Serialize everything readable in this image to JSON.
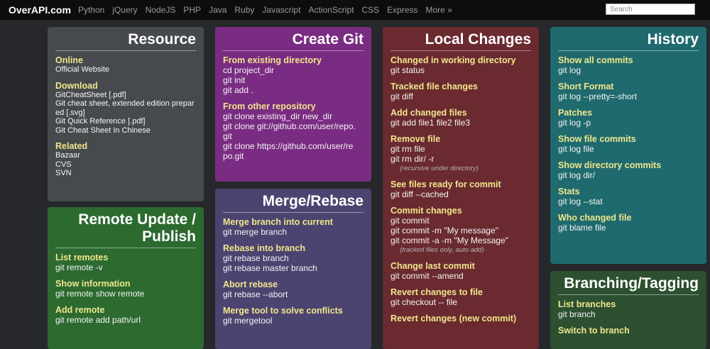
{
  "header": {
    "logo": "OverAPI.com",
    "nav": [
      "Python",
      "jQuery",
      "NodeJS",
      "PHP",
      "Java",
      "Ruby",
      "Javascript",
      "ActionScript",
      "CSS",
      "Express",
      "More »"
    ],
    "search_placeholder": "Search"
  },
  "colors": {
    "resource": "#474a4d",
    "remote": "#2c6a30",
    "create": "#7a2c82",
    "merge": "#4c4470",
    "local": "#6a2a30",
    "history": "#1f6a6e",
    "branching": "#2c5030",
    "heading": "#f0e68c"
  },
  "cards": {
    "resource": {
      "title": "Resource",
      "sections": [
        {
          "heading": "Online",
          "lines": [
            "Official Website"
          ]
        },
        {
          "heading": "Download",
          "lines": [
            "GitCheatSheet [.pdf]",
            "Git cheat sheet, extended edition prepar",
            "ed [.svg]",
            "Git Quick Reference [.pdf]",
            "Git Cheat Sheet In Chinese"
          ]
        },
        {
          "heading": "Related",
          "lines": [
            "Bazaar",
            "CVS",
            "SVN"
          ]
        }
      ]
    },
    "remote": {
      "title_line1": "Remote Update /",
      "title_line2": "Publish",
      "sections": [
        {
          "heading": "List remotes",
          "lines": [
            "git remote -v"
          ]
        },
        {
          "heading": "Show information",
          "lines": [
            "git remote show remote"
          ]
        },
        {
          "heading": "Add remote",
          "lines": [
            "git remote add path/url"
          ]
        }
      ]
    },
    "create": {
      "title": "Create Git",
      "sections": [
        {
          "heading": "From existing directory",
          "lines": [
            "cd project_dir",
            "git init",
            "git add ."
          ]
        },
        {
          "heading": "From other repository",
          "lines": [
            "git clone existing_dir new_dir",
            "git clone git://github.com/user/repo.",
            "git",
            "git clone https://github.com/user/re",
            "po.git"
          ]
        }
      ]
    },
    "merge": {
      "title": "Merge/Rebase",
      "sections": [
        {
          "heading": "Merge branch into current",
          "lines": [
            "git merge branch"
          ]
        },
        {
          "heading": "Rebase into branch",
          "lines": [
            "git rebase branch",
            "git rebase master branch"
          ]
        },
        {
          "heading": "Abort rebase",
          "lines": [
            "git rebase --abort"
          ]
        },
        {
          "heading": "Merge tool to solve conflicts",
          "lines": [
            "git mergetool"
          ]
        }
      ]
    },
    "local": {
      "title": "Local Changes",
      "sections": [
        {
          "heading": "Changed in working directory",
          "lines": [
            "git status"
          ]
        },
        {
          "heading": "Tracked file changes",
          "lines": [
            "git diff"
          ]
        },
        {
          "heading": "Add changed files",
          "lines": [
            "git add file1 file2 file3"
          ]
        },
        {
          "heading": "Remove file",
          "lines": [
            "git rm file",
            "git rm dir/ -r"
          ],
          "note": "(recursive under directory)"
        },
        {
          "heading": "See files ready for commit",
          "lines": [
            "git diff --cached"
          ]
        },
        {
          "heading": "Commit changes",
          "lines": [
            "git commit",
            "git commit -m \"My message\"",
            "git commit -a -m \"My Message\""
          ],
          "note": "(tracked files only, auto add)"
        },
        {
          "heading": "Change last commit",
          "lines": [
            "git commit --amend"
          ]
        },
        {
          "heading": "Revert changes to file",
          "lines": [
            "git checkout -- file"
          ]
        },
        {
          "heading": "Revert changes (new commit)",
          "lines": []
        }
      ]
    },
    "history": {
      "title": "History",
      "sections": [
        {
          "heading": "Show all commits",
          "lines": [
            "git log"
          ]
        },
        {
          "heading": "Short Format",
          "lines": [
            "git log --pretty=-short"
          ]
        },
        {
          "heading": "Patches",
          "lines": [
            "git log -p"
          ]
        },
        {
          "heading": "Show file commits",
          "lines": [
            "git log file"
          ]
        },
        {
          "heading": "Show directory commits",
          "lines": [
            "git log dir/"
          ]
        },
        {
          "heading": "Stats",
          "lines": [
            "git log --stat"
          ]
        },
        {
          "heading": "Who changed file",
          "lines": [
            "git blame file"
          ]
        }
      ]
    },
    "branching": {
      "title": "Branching/Tagging",
      "sections": [
        {
          "heading": "List branches",
          "lines": [
            "git branch"
          ]
        },
        {
          "heading": "Switch to branch",
          "lines": []
        }
      ]
    }
  }
}
